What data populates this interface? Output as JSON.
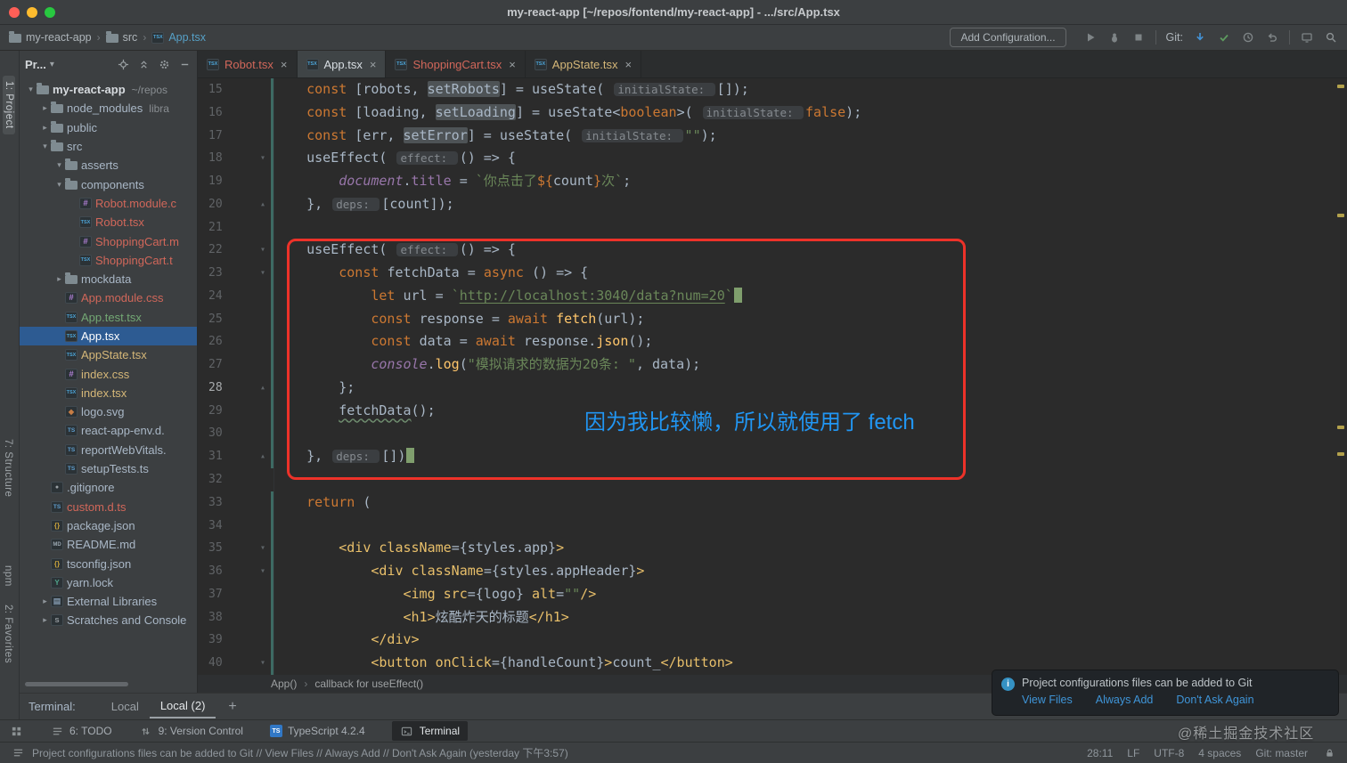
{
  "window": {
    "title": "my-react-app [~/repos/fontend/my-react-app] - .../src/App.tsx"
  },
  "toolbar": {
    "breadcrumbs": [
      {
        "label": "my-react-app",
        "icon": "folder"
      },
      {
        "label": "src",
        "icon": "folder"
      },
      {
        "label": "App.tsx",
        "icon": "tsx",
        "color": "#56a0c6"
      }
    ],
    "add_configuration": "Add Configuration...",
    "git_label": "Git:",
    "actions": [
      "run",
      "debug",
      "stop",
      "divider",
      "git-label",
      "update",
      "commit",
      "history",
      "revert",
      "divider",
      "preview",
      "search"
    ]
  },
  "tool_stripes": {
    "project": "1: Project",
    "structure": "7: Structure",
    "npm": "npm",
    "favorites": "2: Favorites"
  },
  "project_panel": {
    "header": {
      "title": "Pr...",
      "icons": [
        "locate",
        "collapse",
        "gear",
        "minus"
      ]
    },
    "tree": [
      {
        "label": "my-react-app",
        "suffix": "~/repos",
        "depth": 0,
        "icon": "folder",
        "state": "expanded",
        "root": true
      },
      {
        "label": "node_modules",
        "suffix": "libra",
        "depth": 1,
        "icon": "folder",
        "state": "collapsed"
      },
      {
        "label": "public",
        "depth": 1,
        "icon": "folder",
        "state": "collapsed"
      },
      {
        "label": "src",
        "depth": 1,
        "icon": "folder",
        "state": "expanded"
      },
      {
        "label": "asserts",
        "depth": 2,
        "icon": "folder",
        "state": "expanded"
      },
      {
        "label": "components",
        "depth": 2,
        "icon": "folder",
        "state": "expanded"
      },
      {
        "label": "Robot.module.c",
        "depth": 3,
        "icon": "css",
        "color": "#d1675a"
      },
      {
        "label": "Robot.tsx",
        "depth": 3,
        "icon": "tsx",
        "color": "#d1675a"
      },
      {
        "label": "ShoppingCart.m",
        "depth": 3,
        "icon": "css",
        "color": "#d1675a"
      },
      {
        "label": "ShoppingCart.t",
        "depth": 3,
        "icon": "tsx",
        "color": "#d1675a"
      },
      {
        "label": "mockdata",
        "depth": 2,
        "icon": "folder",
        "state": "collapsed"
      },
      {
        "label": "App.module.css",
        "depth": 2,
        "icon": "css",
        "color": "#d1675a"
      },
      {
        "label": "App.test.tsx",
        "depth": 2,
        "icon": "tsx",
        "color": "#73a874"
      },
      {
        "label": "App.tsx",
        "depth": 2,
        "icon": "tsx",
        "selected": true
      },
      {
        "label": "AppState.tsx",
        "depth": 2,
        "icon": "tsx",
        "color": "#d5b778"
      },
      {
        "label": "index.css",
        "depth": 2,
        "icon": "css",
        "color": "#d5b778"
      },
      {
        "label": "index.tsx",
        "depth": 2,
        "icon": "tsx",
        "color": "#d5b778"
      },
      {
        "label": "logo.svg",
        "depth": 2,
        "icon": "img"
      },
      {
        "label": "react-app-env.d.",
        "depth": 2,
        "icon": "ts"
      },
      {
        "label": "reportWebVitals.",
        "depth": 2,
        "icon": "ts"
      },
      {
        "label": "setupTests.ts",
        "depth": 2,
        "icon": "ts"
      },
      {
        "label": ".gitignore",
        "depth": 1,
        "icon": "git"
      },
      {
        "label": "custom.d.ts",
        "depth": 1,
        "icon": "ts",
        "color": "#d1675a"
      },
      {
        "label": "package.json",
        "depth": 1,
        "icon": "json"
      },
      {
        "label": "README.md",
        "depth": 1,
        "icon": "md"
      },
      {
        "label": "tsconfig.json",
        "depth": 1,
        "icon": "json"
      },
      {
        "label": "yarn.lock",
        "depth": 1,
        "icon": "yarn"
      },
      {
        "label": "External Libraries",
        "depth": 1,
        "icon": "lib",
        "state": "collapsed"
      },
      {
        "label": "Scratches and Console",
        "depth": 1,
        "icon": "scratch",
        "state": "collapsed"
      }
    ]
  },
  "editor": {
    "tabs": [
      {
        "label": "Robot.tsx",
        "color": "#d1675a"
      },
      {
        "label": "App.tsx",
        "active": true,
        "color": "#d8dee3"
      },
      {
        "label": "ShoppingCart.tsx",
        "color": "#d1675a"
      },
      {
        "label": "AppState.tsx",
        "color": "#d5b778"
      }
    ],
    "breadcrumb": {
      "items": [
        "App()",
        "callback for useEffect()"
      ]
    },
    "code": {
      "lines": [
        {
          "n": 15,
          "i": 1,
          "t": [
            [
              "const ",
              "kw"
            ],
            [
              "[robots, ",
              "pl"
            ],
            [
              "setRobots",
              "hl"
            ],
            [
              "] = ",
              "pl"
            ],
            [
              "useState",
              "pl"
            ],
            [
              "( ",
              "pl"
            ],
            [
              "initialState: ",
              "hint"
            ],
            [
              "[]);",
              "pl"
            ]
          ]
        },
        {
          "n": 16,
          "i": 1,
          "t": [
            [
              "const ",
              "kw"
            ],
            [
              "[loading, ",
              "pl"
            ],
            [
              "setLoading",
              "hl"
            ],
            [
              "] = ",
              "pl"
            ],
            [
              "useState",
              "pl"
            ],
            [
              "<",
              "pl"
            ],
            [
              "boolean",
              "kw"
            ],
            [
              ">( ",
              "pl"
            ],
            [
              "initialState: ",
              "hint"
            ],
            [
              "false",
              "kw"
            ],
            [
              ");",
              "pl"
            ]
          ]
        },
        {
          "n": 17,
          "i": 1,
          "t": [
            [
              "const ",
              "kw"
            ],
            [
              "[err, ",
              "pl"
            ],
            [
              "setError",
              "hl"
            ],
            [
              "] = ",
              "pl"
            ],
            [
              "useState",
              "pl"
            ],
            [
              "( ",
              "pl"
            ],
            [
              "initialState: ",
              "hint"
            ],
            [
              "\"\"",
              "str"
            ],
            [
              ");",
              "pl"
            ]
          ]
        },
        {
          "n": 18,
          "i": 1,
          "f": "d",
          "t": [
            [
              "useEffect",
              "pl"
            ],
            [
              "( ",
              "pl"
            ],
            [
              "effect: ",
              "hint"
            ],
            [
              "() => {",
              "pl"
            ]
          ]
        },
        {
          "n": 19,
          "i": 2,
          "t": [
            [
              "document",
              "obj"
            ],
            [
              ".",
              "pl"
            ],
            [
              "title",
              "fld"
            ],
            [
              " = ",
              "pl"
            ],
            [
              "`你点击了",
              "str"
            ],
            [
              "${",
              "kw"
            ],
            [
              "count",
              "pl"
            ],
            [
              "}",
              "kw"
            ],
            [
              "次`",
              "str"
            ],
            [
              ";",
              "pl"
            ]
          ]
        },
        {
          "n": 20,
          "i": 1,
          "f": "u",
          "t": [
            [
              "}, ",
              "pl"
            ],
            [
              "deps: ",
              "hint"
            ],
            [
              "[count]);",
              "pl"
            ]
          ]
        },
        {
          "n": 21,
          "i": 0,
          "t": []
        },
        {
          "n": 22,
          "i": 1,
          "f": "d",
          "t": [
            [
              "useEffect",
              "pl"
            ],
            [
              "( ",
              "pl"
            ],
            [
              "effect: ",
              "hint"
            ],
            [
              "() => {",
              "pl"
            ]
          ]
        },
        {
          "n": 23,
          "i": 2,
          "f": "d",
          "t": [
            [
              "const ",
              "kw"
            ],
            [
              "fetchData",
              "pl"
            ],
            [
              " = ",
              "pl"
            ],
            [
              "async",
              "kw"
            ],
            [
              " () => {",
              "pl"
            ]
          ]
        },
        {
          "n": 24,
          "i": 3,
          "t": [
            [
              "let ",
              "kw"
            ],
            [
              "url",
              "pl"
            ],
            [
              " = ",
              "pl"
            ],
            [
              "`",
              "str"
            ],
            [
              "http://localhost:3040/data?num=20",
              "strU"
            ],
            [
              "`",
              "str"
            ],
            [
              "",
              "caret"
            ]
          ]
        },
        {
          "n": 25,
          "i": 3,
          "t": [
            [
              "const ",
              "kw"
            ],
            [
              "response",
              "pl"
            ],
            [
              " = ",
              "pl"
            ],
            [
              "await ",
              "kw"
            ],
            [
              "fetch",
              "fn"
            ],
            [
              "(url);",
              "pl"
            ]
          ]
        },
        {
          "n": 26,
          "i": 3,
          "t": [
            [
              "const ",
              "kw"
            ],
            [
              "data",
              "pl"
            ],
            [
              " = ",
              "pl"
            ],
            [
              "await ",
              "kw"
            ],
            [
              "response",
              "pl"
            ],
            [
              ".",
              "pl"
            ],
            [
              "json",
              "fn"
            ],
            [
              "();",
              "pl"
            ]
          ]
        },
        {
          "n": 27,
          "i": 3,
          "t": [
            [
              "console",
              "obj"
            ],
            [
              ".",
              "pl"
            ],
            [
              "log",
              "fn"
            ],
            [
              "(",
              "pl"
            ],
            [
              "\"模拟请求的数据为20条: \"",
              "str"
            ],
            [
              ", data);",
              "pl"
            ]
          ]
        },
        {
          "n": 28,
          "i": 2,
          "f": "u",
          "active": true,
          "t": [
            [
              "};",
              "pl"
            ]
          ]
        },
        {
          "n": 29,
          "i": 2,
          "t": [
            [
              "fetchData",
              "wavy"
            ],
            [
              "();",
              "pl"
            ]
          ]
        },
        {
          "n": 30,
          "i": 0,
          "t": []
        },
        {
          "n": 31,
          "i": 1,
          "f": "u",
          "t": [
            [
              "}, ",
              "pl"
            ],
            [
              "deps: ",
              "hint"
            ],
            [
              "[])",
              "pl"
            ],
            [
              "",
              "caret"
            ]
          ]
        },
        {
          "n": 32,
          "i": 0,
          "t": []
        },
        {
          "n": 33,
          "i": 1,
          "t": [
            [
              "return",
              "kw"
            ],
            [
              " (",
              "pl"
            ]
          ]
        },
        {
          "n": 34,
          "i": 0,
          "t": []
        },
        {
          "n": 35,
          "i": 2,
          "f": "d",
          "t": [
            [
              "<div",
              "tag"
            ],
            [
              " className",
              "tag"
            ],
            [
              "=",
              "pl"
            ],
            [
              "{styles.app}",
              "pl"
            ],
            [
              ">",
              "tag"
            ]
          ]
        },
        {
          "n": 36,
          "i": 3,
          "f": "d",
          "t": [
            [
              "<div",
              "tag"
            ],
            [
              " className",
              "tag"
            ],
            [
              "=",
              "pl"
            ],
            [
              "{styles.appHeader}",
              "pl"
            ],
            [
              ">",
              "tag"
            ]
          ]
        },
        {
          "n": 37,
          "i": 4,
          "t": [
            [
              "<img",
              "tag"
            ],
            [
              " src",
              "tag"
            ],
            [
              "=",
              "pl"
            ],
            [
              "{logo}",
              "pl"
            ],
            [
              " alt",
              "tag"
            ],
            [
              "=",
              "pl"
            ],
            [
              "\"\"",
              "str"
            ],
            [
              "/>",
              "tag"
            ]
          ]
        },
        {
          "n": 38,
          "i": 4,
          "t": [
            [
              "<h1",
              "tag"
            ],
            [
              ">",
              "tag"
            ],
            [
              "炫酷炸天的标题",
              "pl"
            ],
            [
              "</h1>",
              "tag"
            ]
          ]
        },
        {
          "n": 39,
          "i": 3,
          "t": [
            [
              "</div>",
              "tag"
            ]
          ]
        },
        {
          "n": 40,
          "i": 3,
          "f": "d",
          "t": [
            [
              "<button",
              "tag"
            ],
            [
              " onClick",
              "tag"
            ],
            [
              "=",
              "pl"
            ],
            [
              "{handleCount}",
              "pl"
            ],
            [
              ">",
              "tag"
            ],
            [
              "count_",
              "pl"
            ],
            [
              "</button>",
              "tag"
            ]
          ]
        }
      ]
    }
  },
  "annotations": {
    "note": "因为我比较懒，所以就使用了 fetch",
    "note_color": "#2196f3",
    "box_color": "#ed3229"
  },
  "terminal": {
    "label": "Terminal:",
    "tabs": [
      {
        "label": "Local"
      },
      {
        "label": "Local (2)",
        "active": true
      }
    ],
    "new_tab_label": "+"
  },
  "notification": {
    "message": "Project configurations files can be added to Git",
    "links": [
      "View Files",
      "Always Add",
      "Don't Ask Again"
    ]
  },
  "bottom_bar": {
    "items": [
      {
        "label": "6: TODO",
        "icon": "todo"
      },
      {
        "label": "9: Version Control",
        "icon": "vcs"
      },
      {
        "label": "TypeScript 4.2.4",
        "icon": "ts"
      },
      {
        "label": "Terminal",
        "icon": "term",
        "active": true
      }
    ]
  },
  "status_bar": {
    "message": "Project configurations files can be added to Git // View Files // Always Add // Don't Ask Again (yesterday 下午3:57)",
    "items": [
      "28:11",
      "LF",
      "UTF-8",
      "4 spaces",
      "Git: master"
    ],
    "watermark": "@稀土掘金技术社区"
  },
  "palette": {
    "panel_bg": "#3c3f41",
    "editor_bg": "#2b2b2b",
    "selection_blue": "#2d5b92",
    "keyword_orange": "#cc7832",
    "string_green": "#6a8759",
    "function_yellow": "#ffc66b",
    "annotation_red": "#ed3229",
    "annotation_blue": "#2196f3",
    "link_blue": "#3f95d8"
  }
}
